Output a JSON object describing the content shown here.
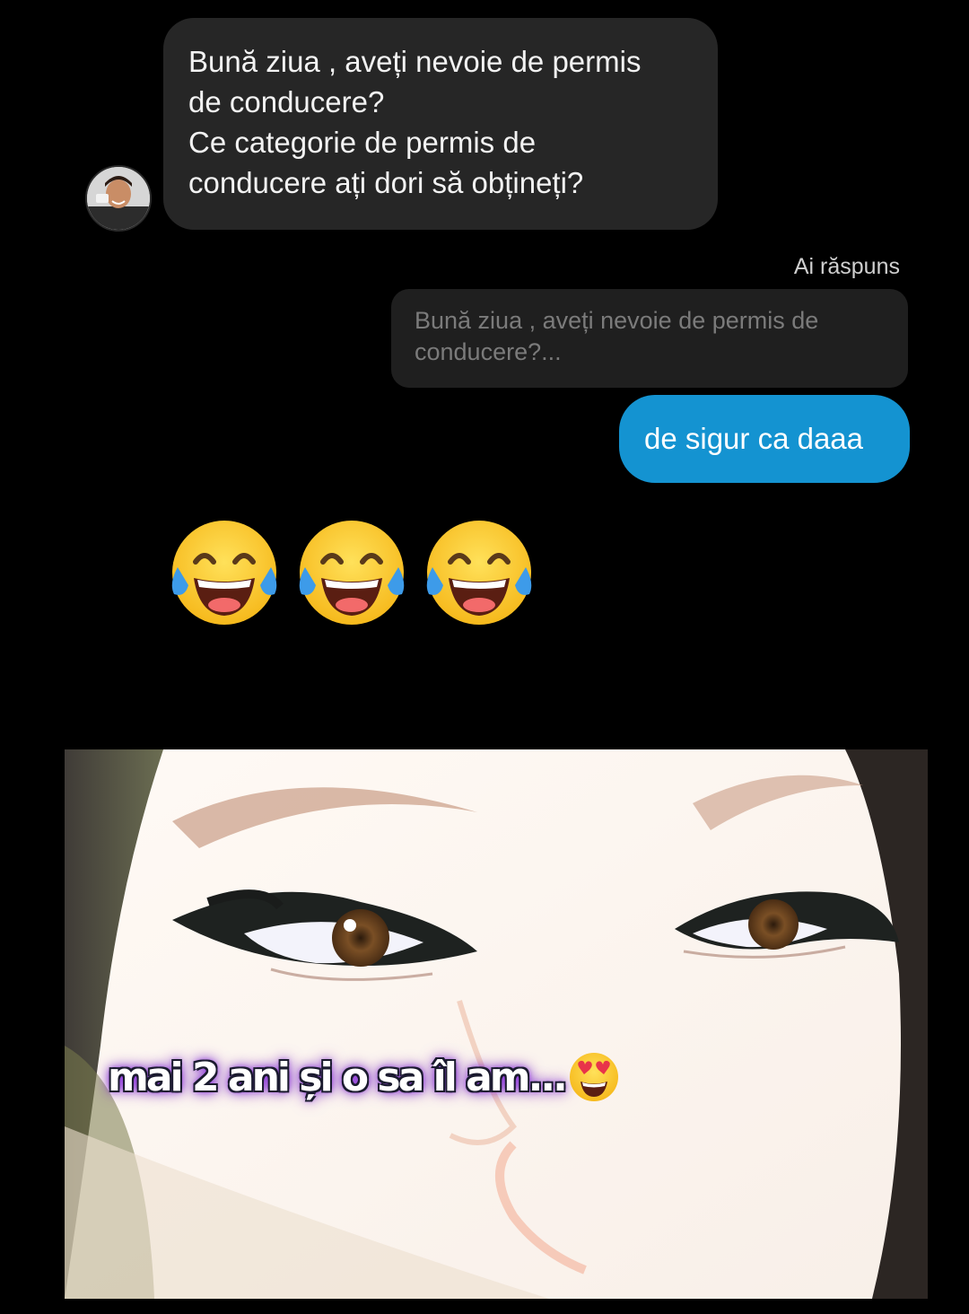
{
  "incoming_message": {
    "lines": [
      "Bună ziua , aveți nevoie de permis",
      "de conducere?",
      "Ce categorie de permis de",
      "conducere ați dori să obțineți?"
    ]
  },
  "reply": {
    "label": "Ai răspuns",
    "quoted_lines": [
      "Bună ziua , aveți nevoie de permis de",
      "conducere?..."
    ],
    "text": "de sigur ca daaa"
  },
  "emojis": [
    "face-with-tears-of-joy-icon",
    "face-with-tears-of-joy-icon",
    "face-with-tears-of-joy-icon"
  ],
  "photo": {
    "caption": "mai 2 ani și o sa îl am...",
    "caption_emoji": "heart-eyes-face-icon"
  },
  "colors": {
    "background": "#000000",
    "incoming_bubble": "#262626",
    "outgoing_bubble": "#1493d1",
    "quote_bubble": "#1f1f1f",
    "caption_glow": "#8a2be2"
  }
}
